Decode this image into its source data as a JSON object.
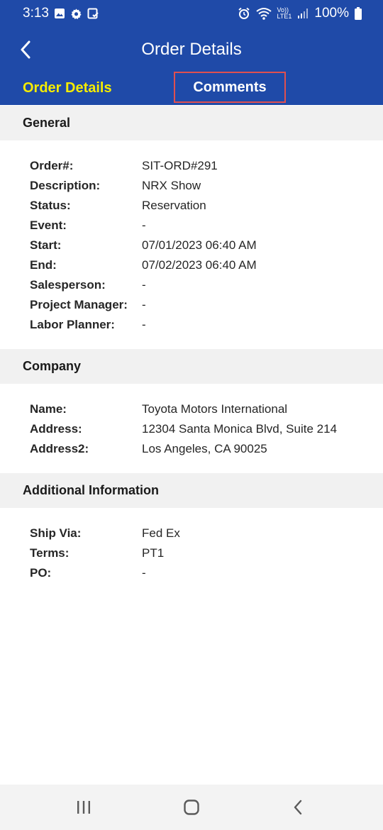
{
  "status_bar": {
    "time": "3:13",
    "left_icons": [
      "image-icon",
      "settings-icon",
      "clipboard-icon"
    ],
    "right_icons": [
      "alarm-icon",
      "wifi-icon",
      "volte-icon",
      "signal-icon",
      "battery-icon"
    ],
    "volte_label_top": "Vo))",
    "volte_label_bottom": "LTE1",
    "battery": "100%"
  },
  "app_bar": {
    "title": "Order Details",
    "back_icon": "chevron-left-icon"
  },
  "tabs": [
    {
      "label": "Order Details",
      "active": true
    },
    {
      "label": "Comments",
      "active": false
    }
  ],
  "colors": {
    "header_bg": "#1f4aa8",
    "active_tab": "#f5ec00",
    "highlight_border": "#e05050",
    "section_bg": "#f1f1f1"
  },
  "sections": {
    "general": {
      "title": "General",
      "rows": [
        {
          "label": "Order#:",
          "value": "SIT-ORD#291"
        },
        {
          "label": "Description:",
          "value": "NRX Show"
        },
        {
          "label": "Status:",
          "value": "Reservation"
        },
        {
          "label": "Event:",
          "value": "-"
        },
        {
          "label": "Start:",
          "value": "07/01/2023 06:40 AM"
        },
        {
          "label": "End:",
          "value": "07/02/2023 06:40 AM"
        },
        {
          "label": "Salesperson:",
          "value": "-"
        },
        {
          "label": "Project Manager:",
          "value": "-"
        },
        {
          "label": "Labor Planner:",
          "value": "-"
        }
      ]
    },
    "company": {
      "title": "Company",
      "rows": [
        {
          "label": "Name:",
          "value": "Toyota Motors International"
        },
        {
          "label": "Address:",
          "value": "12304 Santa Monica Blvd, Suite 214"
        },
        {
          "label": "Address2:",
          "value": "Los Angeles, CA 90025"
        }
      ]
    },
    "additional": {
      "title": "Additional Information",
      "rows": [
        {
          "label": "Ship Via:",
          "value": "Fed Ex"
        },
        {
          "label": "Terms:",
          "value": "PT1"
        },
        {
          "label": "PO:",
          "value": "-"
        }
      ]
    }
  },
  "nav_bar": {
    "buttons": [
      "recents-icon",
      "home-icon",
      "back-icon"
    ]
  }
}
